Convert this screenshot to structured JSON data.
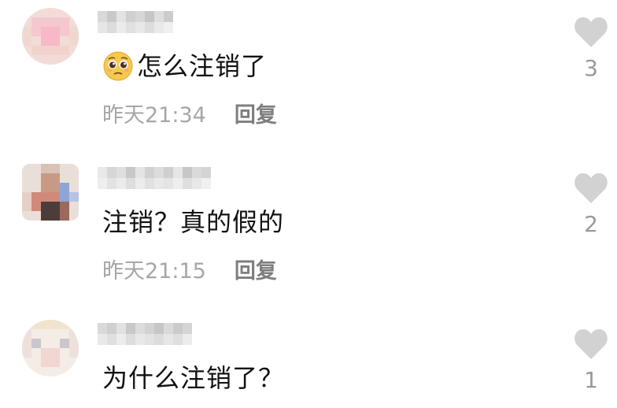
{
  "comments": [
    {
      "text": "怎么注销了",
      "has_emoji": true,
      "emoji": "pleading-face",
      "time": "昨天21:34",
      "reply_label": "回复",
      "likes": "3"
    },
    {
      "text": "注销？真的假的",
      "has_emoji": false,
      "time": "昨天21:15",
      "reply_label": "回复",
      "likes": "2"
    },
    {
      "text": "为什么注销了？",
      "has_emoji": false,
      "time": "",
      "reply_label": "",
      "likes": "1"
    }
  ],
  "colors": {
    "time": "#a6a6a6",
    "reply": "#7e7e7e",
    "heart": "#d2d2d2",
    "count": "#9a9a9a"
  }
}
